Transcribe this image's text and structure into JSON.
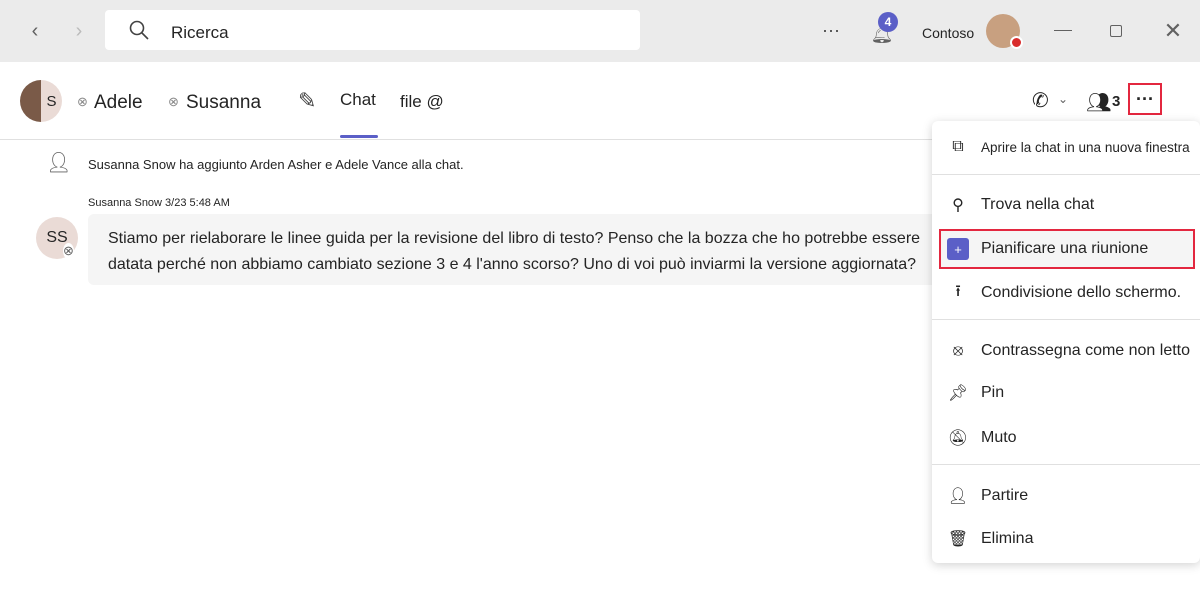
{
  "titlebar": {
    "search_placeholder": "Ricerca",
    "notifications_count": "4",
    "org": "Contoso"
  },
  "header": {
    "participants": [
      "Adele",
      "Susanna"
    ],
    "tabs": [
      {
        "label": "Chat",
        "active": true
      },
      {
        "label": "file @",
        "active": false
      }
    ],
    "people_count": "3",
    "accent": "#5b5fc7"
  },
  "messages": {
    "system": "Susanna Snow ha aggiunto Arden Asher e Adele Vance alla chat.",
    "meta": "Susanna Snow 3/23 5:48 AM",
    "avatar": "SS",
    "line1": "Stiamo per rielaborare le linee guida per la revisione del libro di testo? Penso che la bozza che ho potrebbe essere",
    "line2": "datata perché non abbiamo cambiato sezione 3 e 4 l'anno scorso? Uno di voi può inviarmi la versione aggiornata?"
  },
  "menu": {
    "items": [
      {
        "label": "Aprire la chat in una nuova finestra",
        "icon": "pop-out-icon"
      },
      {
        "label": "Trova nella chat",
        "icon": "search-icon"
      },
      {
        "label": "Pianificare una riunione",
        "icon": "calendar-add-icon",
        "highlighted": true
      },
      {
        "label": "Condivisione dello schermo.",
        "icon": "share-screen-icon"
      },
      {
        "label": "Contrassegna come non letto",
        "icon": "unread-icon"
      },
      {
        "label": "Pin",
        "icon": "pin-icon"
      },
      {
        "label": "Muto",
        "icon": "mute-icon"
      },
      {
        "label": "Partire",
        "icon": "leave-icon"
      },
      {
        "label": "Elimina",
        "icon": "delete-icon"
      }
    ]
  },
  "highlight_color": "#e3273f"
}
